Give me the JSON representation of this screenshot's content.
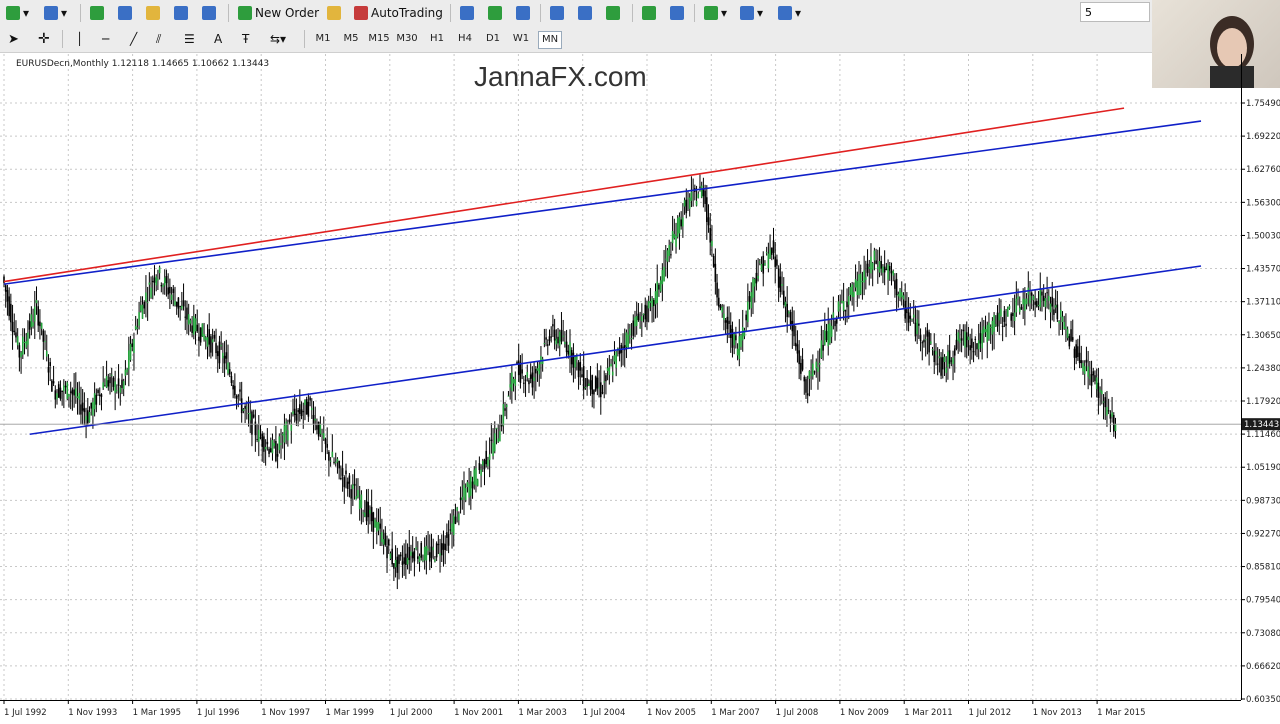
{
  "toolbar": {
    "new_order": "New Order",
    "auto_trading": "AutoTrading",
    "search_value": "5"
  },
  "timeframes": [
    "M1",
    "M5",
    "M15",
    "M30",
    "H1",
    "H4",
    "D1",
    "W1",
    "MN"
  ],
  "active_timeframe": "MN",
  "chart": {
    "info": "EURUSDecn,Monthly  1.12118 1.14665 1.10662 1.13443",
    "watermark": "JannaFX.com",
    "current_price": "1.13443"
  },
  "chart_data": {
    "type": "candlestick",
    "symbol": "EURUSDecn",
    "timeframe": "Monthly",
    "last_bar": {
      "open": 1.12118,
      "high": 1.14665,
      "low": 1.10662,
      "close": 1.13443
    },
    "y_ticks": [
      "1.75490",
      "1.69220",
      "1.62760",
      "1.56300",
      "1.50030",
      "1.43570",
      "1.37110",
      "1.30650",
      "1.24380",
      "1.17920",
      "1.11460",
      "1.05190",
      "0.98730",
      "0.92270",
      "0.85810",
      "0.79540",
      "0.73080",
      "0.66620",
      "0.60350"
    ],
    "x_ticks": [
      "1 Jul 1992",
      "1 Nov 1993",
      "1 Mar 1995",
      "1 Jul 1996",
      "1 Nov 1997",
      "1 Mar 1999",
      "1 Jul 2000",
      "1 Nov 2001",
      "1 Mar 2003",
      "1 Jul 2004",
      "1 Nov 2005",
      "1 Mar 2007",
      "1 Jul 2008",
      "1 Nov 2009",
      "1 Mar 2011",
      "1 Jul 2012",
      "1 Nov 2013",
      "1 Mar 2015"
    ],
    "ylim": [
      0.6035,
      1.7549
    ],
    "price_path": [
      [
        0,
        1.42
      ],
      [
        10,
        1.27
      ],
      [
        20,
        1.36
      ],
      [
        30,
        1.2
      ],
      [
        40,
        1.2
      ],
      [
        50,
        1.15
      ],
      [
        60,
        1.22
      ],
      [
        70,
        1.2
      ],
      [
        80,
        1.35
      ],
      [
        90,
        1.43
      ],
      [
        100,
        1.38
      ],
      [
        110,
        1.33
      ],
      [
        120,
        1.3
      ],
      [
        130,
        1.26
      ],
      [
        140,
        1.17
      ],
      [
        150,
        1.11
      ],
      [
        160,
        1.08
      ],
      [
        170,
        1.15
      ],
      [
        180,
        1.17
      ],
      [
        190,
        1.08
      ],
      [
        200,
        1.03
      ],
      [
        210,
        0.98
      ],
      [
        220,
        0.93
      ],
      [
        230,
        0.86
      ],
      [
        240,
        0.89
      ],
      [
        250,
        0.88
      ],
      [
        260,
        0.91
      ],
      [
        270,
        1.0
      ],
      [
        280,
        1.05
      ],
      [
        290,
        1.12
      ],
      [
        300,
        1.24
      ],
      [
        310,
        1.22
      ],
      [
        320,
        1.31
      ],
      [
        330,
        1.29
      ],
      [
        340,
        1.22
      ],
      [
        350,
        1.2
      ],
      [
        360,
        1.27
      ],
      [
        370,
        1.33
      ],
      [
        380,
        1.36
      ],
      [
        390,
        1.47
      ],
      [
        400,
        1.56
      ],
      [
        410,
        1.59
      ],
      [
        420,
        1.35
      ],
      [
        430,
        1.28
      ],
      [
        440,
        1.42
      ],
      [
        450,
        1.47
      ],
      [
        460,
        1.34
      ],
      [
        470,
        1.2
      ],
      [
        480,
        1.29
      ],
      [
        490,
        1.36
      ],
      [
        500,
        1.4
      ],
      [
        510,
        1.45
      ],
      [
        520,
        1.42
      ],
      [
        530,
        1.34
      ],
      [
        540,
        1.3
      ],
      [
        550,
        1.24
      ],
      [
        560,
        1.3
      ],
      [
        570,
        1.29
      ],
      [
        580,
        1.33
      ],
      [
        590,
        1.35
      ],
      [
        600,
        1.38
      ],
      [
        610,
        1.38
      ],
      [
        620,
        1.33
      ],
      [
        630,
        1.26
      ],
      [
        640,
        1.21
      ],
      [
        650,
        1.13
      ]
    ],
    "trendlines": [
      {
        "color": "#e02020",
        "from": [
          0,
          1.41
        ],
        "to": [
          655,
          1.745
        ]
      },
      {
        "color": "#1020c8",
        "from": [
          0,
          1.405
        ],
        "to": [
          700,
          1.72
        ]
      },
      {
        "color": "#1020c8",
        "from": [
          15,
          1.115
        ],
        "to": [
          700,
          1.44
        ]
      }
    ]
  }
}
